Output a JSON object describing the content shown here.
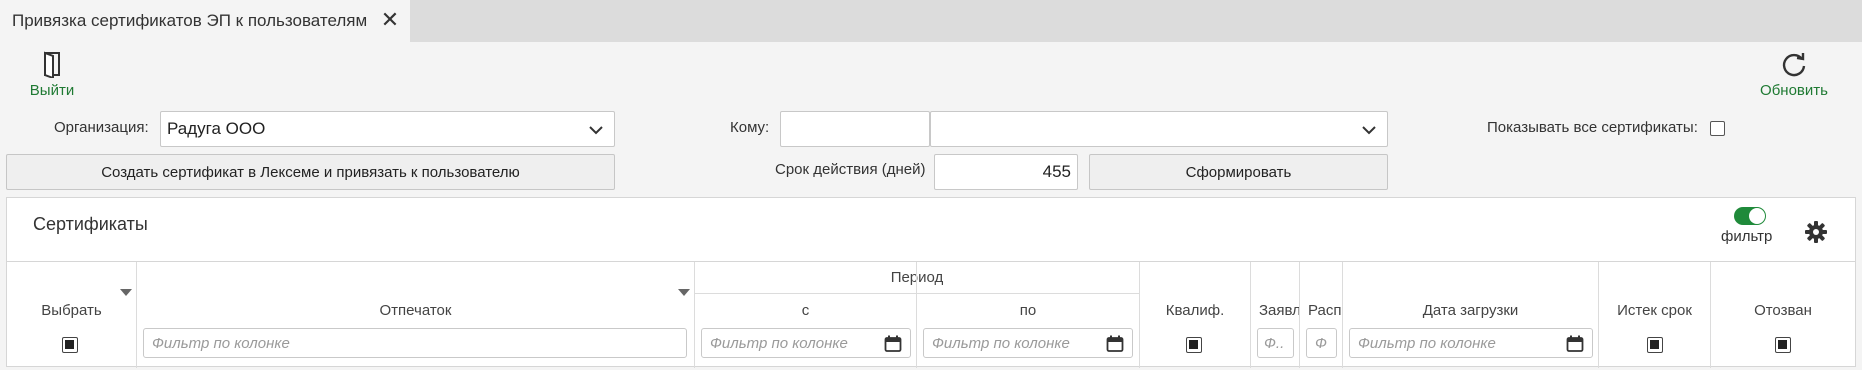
{
  "tab": {
    "title": "Привязка сертификатов ЭП к пользователям",
    "close_icon": "close-icon"
  },
  "toolbar": {
    "exit_label": "Выйти",
    "exit_icon": "door-exit-icon",
    "refresh_label": "Обновить",
    "refresh_icon": "refresh-icon"
  },
  "form": {
    "org_label": "Организация:",
    "org_value": "Радуга ООО",
    "create_btn": "Создать сертификат в Лексеме и привязать к пользователю",
    "to_label": "Кому:",
    "to_value_left": "",
    "to_value_right": "",
    "validity_label": "Срок действия (дней)",
    "validity_value": "455",
    "generate_btn": "Сформировать",
    "show_all_label": "Показывать все сертификаты:"
  },
  "panel": {
    "title": "Сертификаты",
    "filter_toggle_label": "фильтр",
    "filter_toggle_on": true,
    "settings_icon": "gear-icon"
  },
  "grid": {
    "group_period": "Период",
    "columns": {
      "select": "Выбрать",
      "fingerprint": "Отпечаток",
      "from": "с",
      "to": "по",
      "qualified": "Квалиф.",
      "request": "Заявл",
      "distr": "Расп",
      "upload_date": "Дата загрузки",
      "expired": "Истек срок",
      "revoked": "Отозван"
    },
    "filter_placeholder": "Фильтр по колонке",
    "filter_short_1": "Ф..",
    "filter_short_2": "Ф"
  },
  "colors": {
    "accent_green": "#1f7a33",
    "toggle_on": "#1f8a3a"
  }
}
